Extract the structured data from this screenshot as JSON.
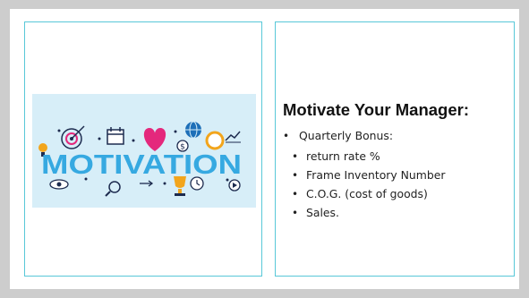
{
  "image": {
    "word": "MOTIVATION",
    "icons": [
      "lightbulb-icon",
      "target-icon",
      "calendar-icon",
      "heart-icon",
      "dollar-icon",
      "globe-icon",
      "pie-chart-icon",
      "growth-chart-icon",
      "eye-icon",
      "magnifier-icon",
      "trophy-icon",
      "clock-icon",
      "play-icon"
    ],
    "colors": {
      "background": "#d7eef8",
      "word": "#36a9e1",
      "heart": "#e4287c",
      "accent": "#f2a51c",
      "dark": "#1d2b4f"
    }
  },
  "panel_right": {
    "heading": "Motivate Your Manager:",
    "bullets": [
      {
        "level": 1,
        "text": "Quarterly Bonus:"
      },
      {
        "level": 2,
        "text": "return rate %"
      },
      {
        "level": 2,
        "text": "Frame Inventory Number"
      },
      {
        "level": 2,
        "text": "C.O.G. (cost of goods)"
      },
      {
        "level": 2,
        "text": "Sales."
      }
    ],
    "bullet_glyph": "•"
  },
  "colors": {
    "border": "#58c8d8",
    "page": "#cdcdcd"
  }
}
